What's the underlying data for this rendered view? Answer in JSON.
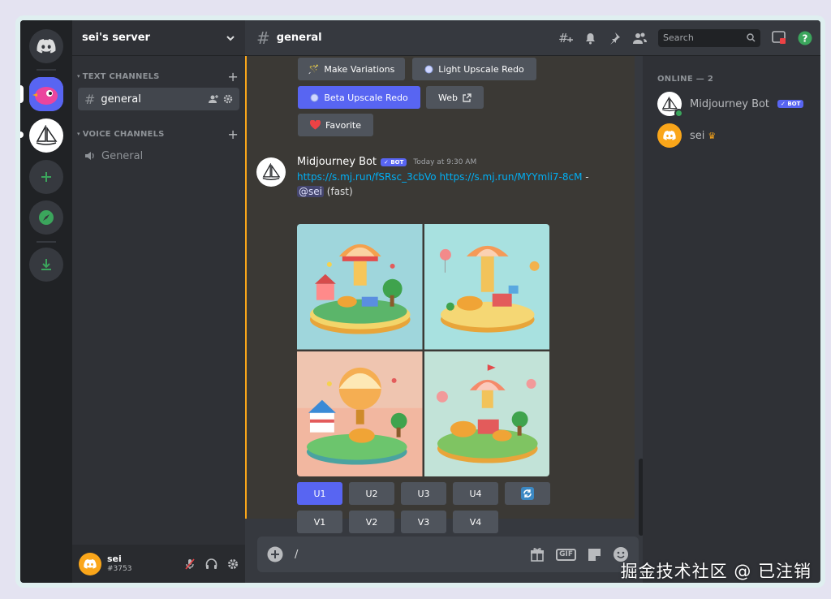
{
  "server": {
    "name": "sei's server",
    "categories": {
      "text": "TEXT CHANNELS",
      "voice": "VOICE CHANNELS"
    },
    "text_channels": [
      "general"
    ],
    "voice_channels": [
      "General"
    ]
  },
  "topbar": {
    "channel": "general",
    "search_placeholder": "Search"
  },
  "buttons_top": {
    "make_variations": "Make Variations",
    "light_upscale_redo": "Light Upscale Redo",
    "beta_upscale_redo": "Beta Upscale Redo",
    "web": "Web",
    "favorite": "Favorite"
  },
  "message": {
    "author": "Midjourney Bot",
    "bot_tag": "✓ BOT",
    "timestamp": "Today at 9:30 AM",
    "link1": "https://s.mj.run/fSRsc_3cbVo",
    "link2": "https://s.mj.run/MYYmli7-8cM",
    "separator": " - ",
    "mention": "@sei",
    "mode": " (fast)"
  },
  "grid_buttons": {
    "upscale": [
      "U1",
      "U2",
      "U3",
      "U4"
    ],
    "variation": [
      "V1",
      "V2",
      "V3",
      "V4"
    ]
  },
  "composer": {
    "value": "/",
    "gif_label": "GIF"
  },
  "user": {
    "name": "sei",
    "tag": "#3753"
  },
  "members": {
    "header": "ONLINE — 2",
    "list": [
      {
        "name": "Midjourney Bot",
        "badge": "✓ BOT"
      },
      {
        "name": "sei",
        "badge": "♛"
      }
    ]
  },
  "watermark": "掘金技术社区 @ 已注销",
  "colors": {
    "blurple": "#5865f2",
    "rail": "#202225",
    "sidebar": "#2f3136",
    "chat": "#36393f",
    "highlight_border": "#faa61a",
    "link": "#00aff4",
    "green": "#3ba55c"
  }
}
